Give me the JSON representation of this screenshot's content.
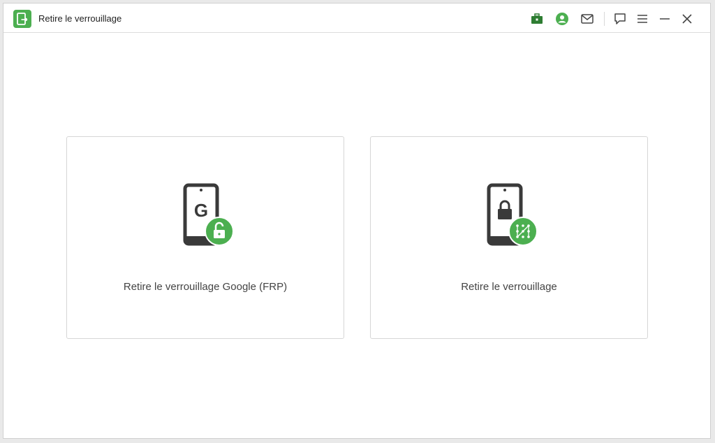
{
  "window": {
    "title": "Retire le verrouillage"
  },
  "titlebar": {
    "icons": [
      "toolbox-icon",
      "account-icon",
      "mail-icon",
      "feedback-icon",
      "menu-icon",
      "minimize-icon",
      "close-icon"
    ]
  },
  "options": [
    {
      "label": "Retire le verrouillage Google (FRP)",
      "icon": "phone-google-unlock-icon"
    },
    {
      "label": "Retire le verrouillage",
      "icon": "phone-pattern-lock-icon"
    }
  ],
  "colors": {
    "accent": "#4caf50",
    "icon_dark": "#3a3a3a"
  }
}
